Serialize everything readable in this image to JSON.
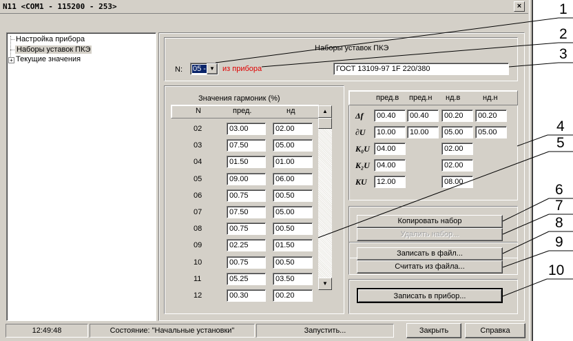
{
  "window": {
    "title": "N11 <COM1 - 115200 - 253>",
    "close_label": "×"
  },
  "tree": {
    "items": [
      {
        "label": "Настройка прибора"
      },
      {
        "label": "Наборы уставок ПКЭ"
      },
      {
        "label": "Текущие значения",
        "expander": "+"
      }
    ]
  },
  "sets_group": {
    "title": "Наборы уставок ПКЭ",
    "n_label": "N:",
    "n_value": "05 -",
    "source_label": "из прибора",
    "standard_value": "ГОСТ 13109-97 1F 220/380"
  },
  "harmonics": {
    "title": "Значения гармоник (%)",
    "columns": [
      "N",
      "пред.",
      "нд"
    ],
    "rows": [
      {
        "n": "02",
        "pred": "03.00",
        "nd": "02.00"
      },
      {
        "n": "03",
        "pred": "07.50",
        "nd": "05.00"
      },
      {
        "n": "04",
        "pred": "01.50",
        "nd": "01.00"
      },
      {
        "n": "05",
        "pred": "09.00",
        "nd": "06.00"
      },
      {
        "n": "06",
        "pred": "00.75",
        "nd": "00.50"
      },
      {
        "n": "07",
        "pred": "07.50",
        "nd": "05.00"
      },
      {
        "n": "08",
        "pred": "00.75",
        "nd": "00.50"
      },
      {
        "n": "09",
        "pred": "02.25",
        "nd": "01.50"
      },
      {
        "n": "10",
        "pred": "00.75",
        "nd": "00.50"
      },
      {
        "n": "11",
        "pred": "05.25",
        "nd": "03.50"
      },
      {
        "n": "12",
        "pred": "00.30",
        "nd": "00.20"
      }
    ]
  },
  "limits": {
    "columns": [
      "пред.в",
      "пред.н",
      "нд.в",
      "нд.н"
    ],
    "rows": [
      {
        "label": "Δf",
        "values": [
          "00.40",
          "00.40",
          "00.20",
          "00.20"
        ]
      },
      {
        "label": "∂U",
        "values": [
          "10.00",
          "10.00",
          "05.00",
          "05.00"
        ]
      },
      {
        "label": "K₀U",
        "values": [
          "04.00",
          "",
          "02.00",
          ""
        ]
      },
      {
        "label": "K₂U",
        "values": [
          "04.00",
          "",
          "02.00",
          ""
        ]
      },
      {
        "label": "KU",
        "values": [
          "12.00",
          "",
          "08.00",
          ""
        ]
      }
    ]
  },
  "buttons": {
    "copy": "Копировать набор",
    "delete": "Удалить набор...",
    "save_file": "Записать в файл...",
    "load_file": "Считать из файла...",
    "write_device": "Записать в прибор..."
  },
  "status": {
    "time": "12:49:48",
    "state": "Состояние: \"Начальные установки\"",
    "run": "Запустить...",
    "close": "Закрыть",
    "help": "Справка"
  },
  "callouts": [
    "1",
    "2",
    "3",
    "4",
    "5",
    "6",
    "7",
    "8",
    "9",
    "10"
  ]
}
